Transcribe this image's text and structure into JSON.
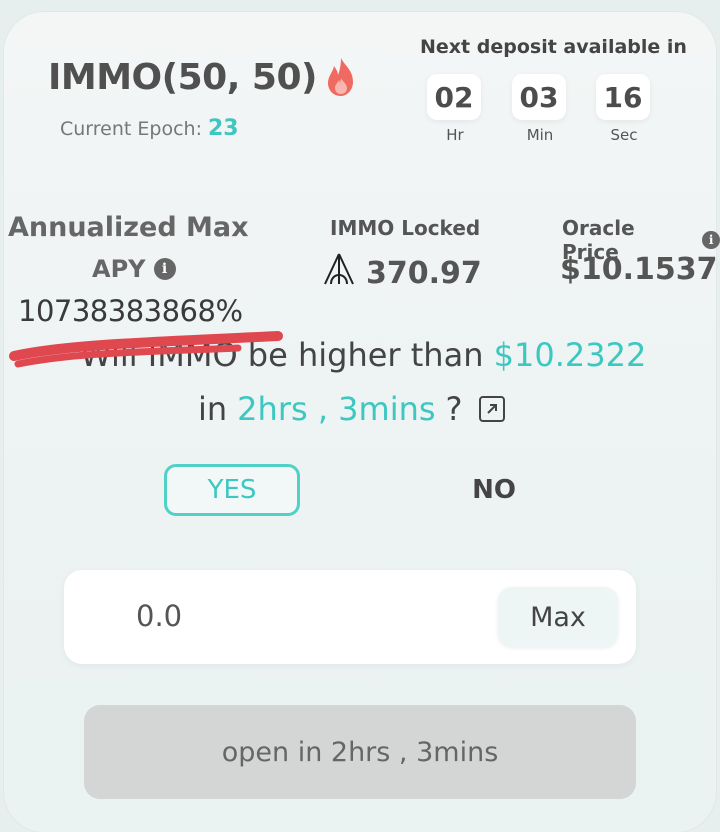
{
  "header": {
    "pair_title": "IMMO(50, 50)",
    "epoch_label": "Current Epoch:",
    "epoch_value": "23",
    "next_deposit_label": "Next deposit available in",
    "timer": [
      {
        "value": "02",
        "unit": "Hr"
      },
      {
        "value": "03",
        "unit": "Min"
      },
      {
        "value": "16",
        "unit": "Sec"
      }
    ]
  },
  "stats": {
    "apy_title": "Annualized Max",
    "apy_sub": "APY",
    "apy_value": "10738383868%",
    "locked_label": "IMMO Locked",
    "locked_value": "370.97",
    "oracle_label": "Oracle Price",
    "oracle_value": "$10.1537"
  },
  "question": {
    "line1_prefix": "Will IMMO be higher than",
    "line1_price": "$10.2322",
    "line2_prefix": "in",
    "line2_time": "2hrs , 3mins",
    "line2_suffix": "?"
  },
  "choices": {
    "yes_label": "YES",
    "no_label": "NO"
  },
  "amount": {
    "value": "0.0",
    "max_label": "Max"
  },
  "action": {
    "open_label": "open in 2hrs , 3mins"
  },
  "colors": {
    "accent": "#3cc8c0",
    "strike": "#e0484f",
    "disabled_button": "#d4d6d6"
  },
  "icons": [
    "fire-icon",
    "info-icon",
    "immo-token-icon",
    "external-link-icon"
  ]
}
